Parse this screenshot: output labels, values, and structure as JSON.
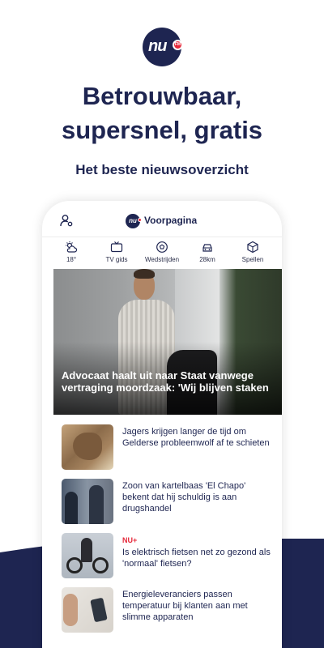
{
  "promo": {
    "headline_line1": "Betrouwbaar,",
    "headline_line2": "supersnel, gratis",
    "subheadline": "Het beste nieuwsoverzicht"
  },
  "app": {
    "title": "Voorpagina",
    "logo_text": "nu",
    "colors": {
      "brand_navy": "#1e2551",
      "accent_red": "#e6283a"
    }
  },
  "shortcuts": [
    {
      "icon": "weather-icon",
      "label": "18°"
    },
    {
      "icon": "tv-icon",
      "label": "TV gids"
    },
    {
      "icon": "football-icon",
      "label": "Wedstrijden"
    },
    {
      "icon": "car-icon",
      "label": "28km"
    },
    {
      "icon": "cube-icon",
      "label": "Spellen"
    }
  ],
  "hero": {
    "title": "Advocaat haalt uit naar Staat vanwege vertraging moordzaak: 'Wij blijven staken"
  },
  "articles": [
    {
      "tag": "",
      "title": "Jagers krijgen langer de tijd om Gelderse probleemwolf af te schieten"
    },
    {
      "tag": "",
      "title": "Zoon van kartelbaas 'El Chapo' bekent dat hij schuldig is aan drugshandel"
    },
    {
      "tag": "NU+",
      "title": "Is elektrisch fietsen net zo gezond als 'normaal' fietsen?"
    },
    {
      "tag": "",
      "title": "Energieleveranciers passen temperatuur bij klanten aan met slimme apparaten"
    }
  ]
}
